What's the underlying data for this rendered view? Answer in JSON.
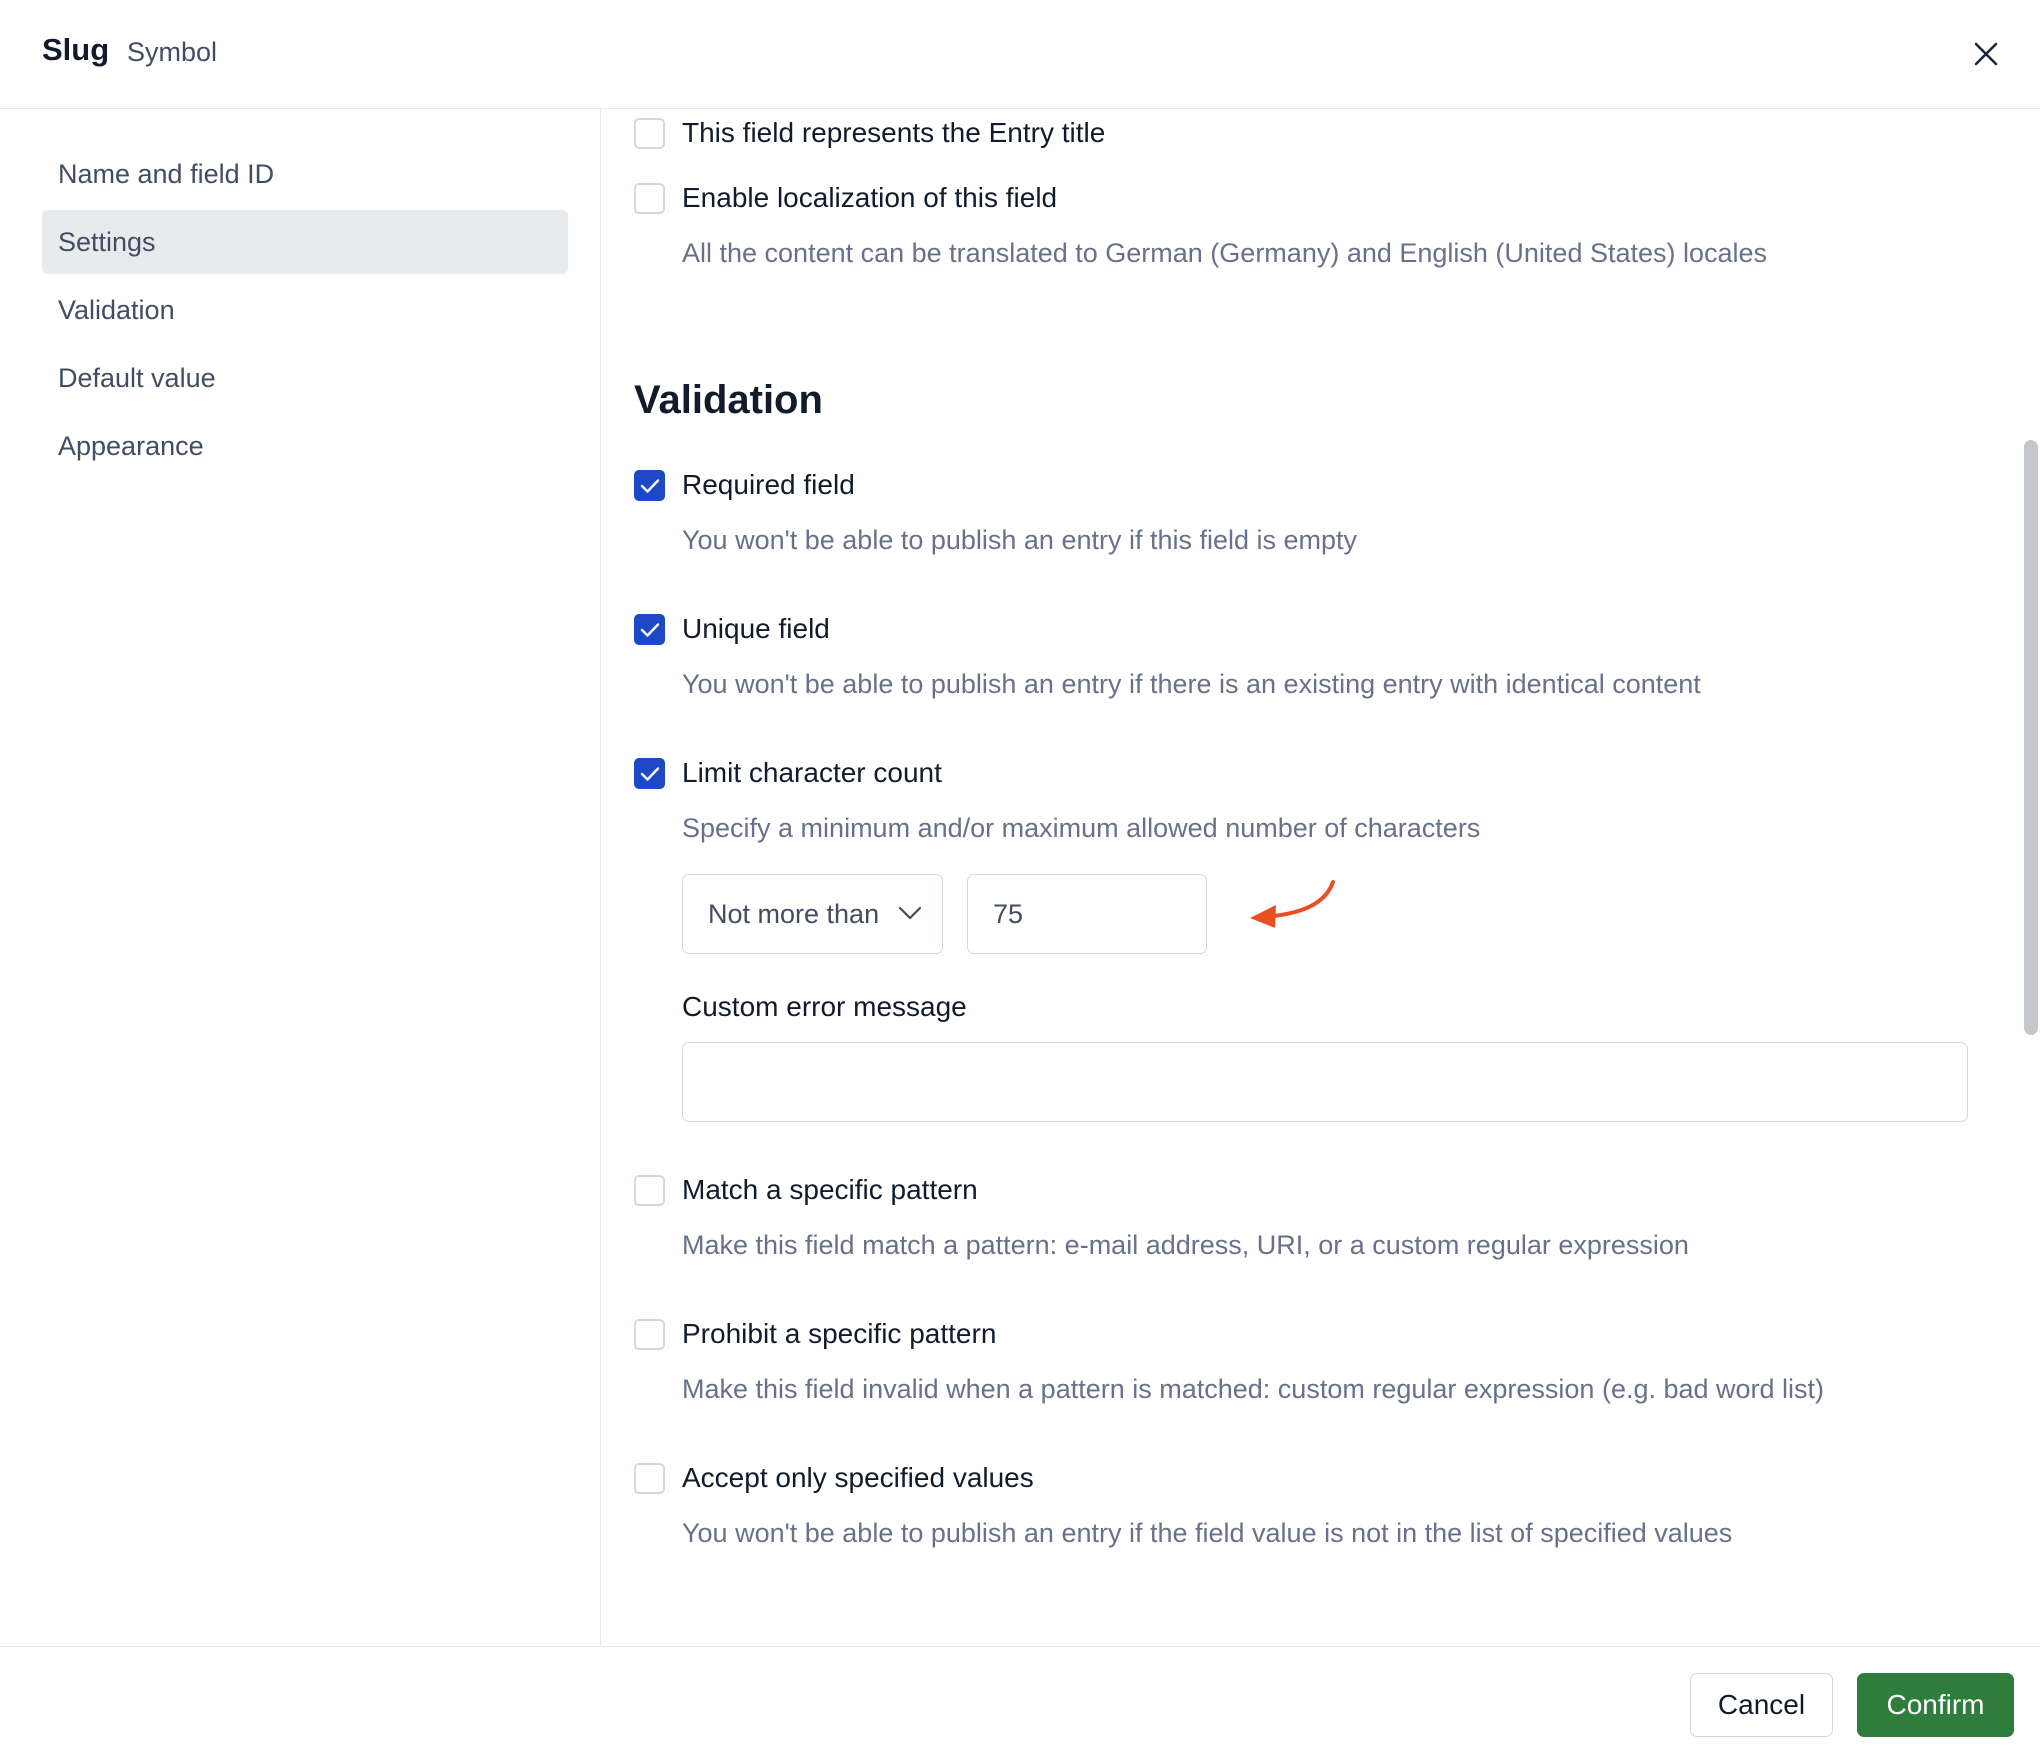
{
  "header": {
    "title": "Slug",
    "subtitle": "Symbol"
  },
  "sidebar": {
    "items": [
      {
        "label": "Name and field ID",
        "active": false
      },
      {
        "label": "Settings",
        "active": true
      },
      {
        "label": "Validation",
        "active": false
      },
      {
        "label": "Default value",
        "active": false
      },
      {
        "label": "Appearance",
        "active": false
      }
    ]
  },
  "settings": {
    "entry_title": {
      "label": "This field represents the Entry title",
      "checked": false
    },
    "localization": {
      "label": "Enable localization of this field",
      "help": "All the content can be translated to German (Germany) and English (United States) locales",
      "checked": false
    }
  },
  "validation": {
    "heading": "Validation",
    "required": {
      "label": "Required field",
      "help": "You won't be able to publish an entry if this field is empty",
      "checked": true
    },
    "unique": {
      "label": "Unique field",
      "help": "You won't be able to publish an entry if there is an existing entry with identical content",
      "checked": true
    },
    "limit": {
      "label": "Limit character count",
      "help": "Specify a minimum and/or maximum allowed number of characters",
      "checked": true,
      "condition": "Not more than",
      "value": "75",
      "custom_error_label": "Custom error message",
      "custom_error_value": ""
    },
    "match_pattern": {
      "label": "Match a specific pattern",
      "help": "Make this field match a pattern: e-mail address, URI, or a custom regular expression",
      "checked": false
    },
    "prohibit_pattern": {
      "label": "Prohibit a specific pattern",
      "help": "Make this field invalid when a pattern is matched: custom regular expression (e.g. bad word list)",
      "checked": false
    },
    "accept_values": {
      "label": "Accept only specified values",
      "help": "You won't be able to publish an entry if the field value is not in the list of specified values",
      "checked": false
    }
  },
  "footer": {
    "cancel_label": "Cancel",
    "confirm_label": "Confirm"
  },
  "colors": {
    "accent": "#1d48c6",
    "confirm": "#2f7d3d",
    "annotation_arrow": "#e94e24"
  }
}
